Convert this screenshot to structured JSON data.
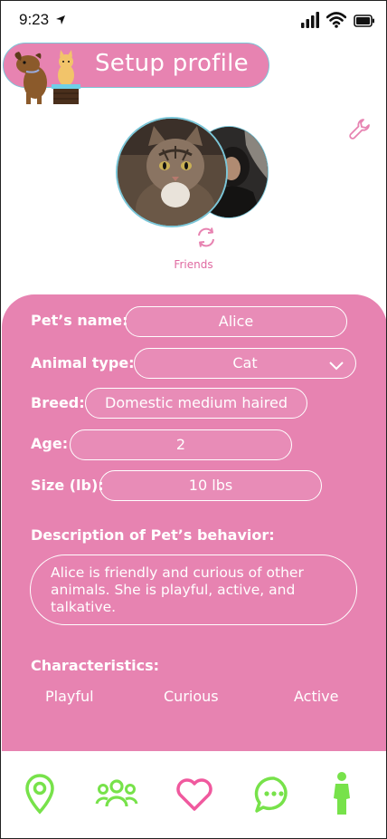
{
  "status_bar": {
    "time": "9:23",
    "icons": [
      "location-arrow-icon",
      "signal-icon",
      "wifi-icon",
      "battery-icon"
    ]
  },
  "header": {
    "title": "Setup profile",
    "mascot_icon": "dog-and-cat-mascot-icon",
    "edit_icon": "wrench-icon"
  },
  "profile": {
    "pet_photo": "cat-photo",
    "owner_photo": "owner-photo",
    "swap_icon": "swap-icon",
    "swap_label": "Friends"
  },
  "form": {
    "pet_name": {
      "label": "Pet’s name:",
      "value": "Alice"
    },
    "animal_type": {
      "label": "Animal type:",
      "value": "Cat"
    },
    "breed": {
      "label": "Breed:",
      "value": "Domestic medium haired"
    },
    "age": {
      "label": "Age:",
      "value": "2"
    },
    "size": {
      "label": "Size (lb):",
      "value": "10 lbs"
    },
    "description": {
      "label": "Description of Pet’s behavior:",
      "value": "Alice is friendly and curious of other animals. She is playful, active, and talkative."
    },
    "characteristics": {
      "label": "Characteristics:",
      "items": [
        "Playful",
        "Curious",
        "Active"
      ]
    }
  },
  "bottom_nav": {
    "items": [
      "map-pin-icon",
      "group-icon",
      "heart-icon",
      "chat-icon",
      "person-icon"
    ]
  },
  "colors": {
    "accent_pink": "#e783b1",
    "nav_green": "#77e24a",
    "heart_pink": "#f0599e",
    "border_blue": "#7bc6d8"
  }
}
